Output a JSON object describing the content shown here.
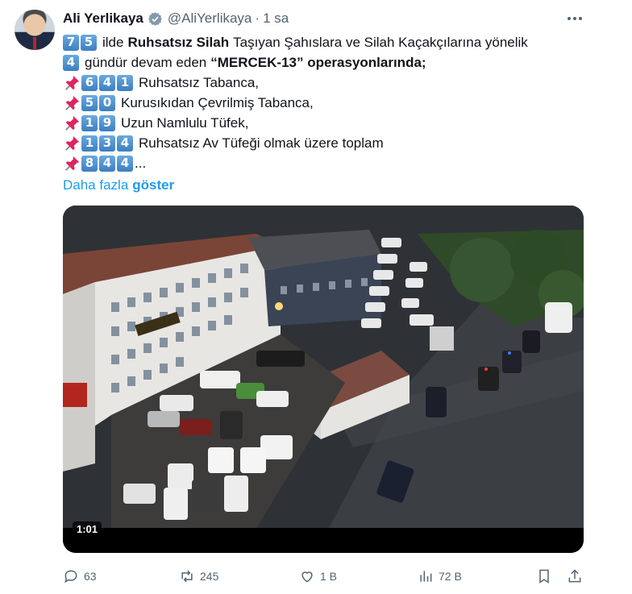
{
  "tweet": {
    "author_name": "Ali Yerlikaya",
    "handle": "@AliYerlikaya",
    "separator": "·",
    "time": "1 sa",
    "lines": {
      "l1_keys": [
        "7",
        "5"
      ],
      "l1_a": "ilde",
      "l1_bold": "Ruhsatsız Silah",
      "l1_b": "Taşıyan Şahıslara ve Silah Kaçakçılarına yönelik",
      "l2_keys": [
        "4"
      ],
      "l2_a": "gündür devam eden",
      "l2_bold": "“MERCEK-13” operasyonlarında;",
      "l3_keys": [
        "6",
        "4",
        "1"
      ],
      "l3_text": "Ruhsatsız Tabanca,",
      "l4_keys": [
        "5",
        "0"
      ],
      "l4_text": "Kurusıkıdan Çevrilmiş Tabanca,",
      "l5_keys": [
        "1",
        "9"
      ],
      "l5_text": "Uzun Namlulu Tüfek,",
      "l6_keys": [
        "1",
        "3",
        "4"
      ],
      "l6_text": "Ruhsatsız Av Tüfeği olmak üzere toplam",
      "l7_keys": [
        "8",
        "4",
        "4"
      ],
      "l7_text": "..."
    },
    "show_more_prefix": "Daha fazla",
    "show_more_strong": "göster",
    "video_duration": "1:01"
  },
  "actions": {
    "replies": "63",
    "reposts": "245",
    "likes": "1 B",
    "views": "72 B"
  },
  "colors": {
    "accent": "#1d9bf0",
    "text": "#0f1419",
    "muted": "#536471",
    "keycap": "#3d7fc1",
    "verified_badge": "#829aab"
  },
  "icons": [
    "verified-badge-icon",
    "more-icon",
    "pushpin-icon",
    "reply-icon",
    "repost-icon",
    "like-icon",
    "views-icon",
    "bookmark-icon",
    "share-icon"
  ]
}
